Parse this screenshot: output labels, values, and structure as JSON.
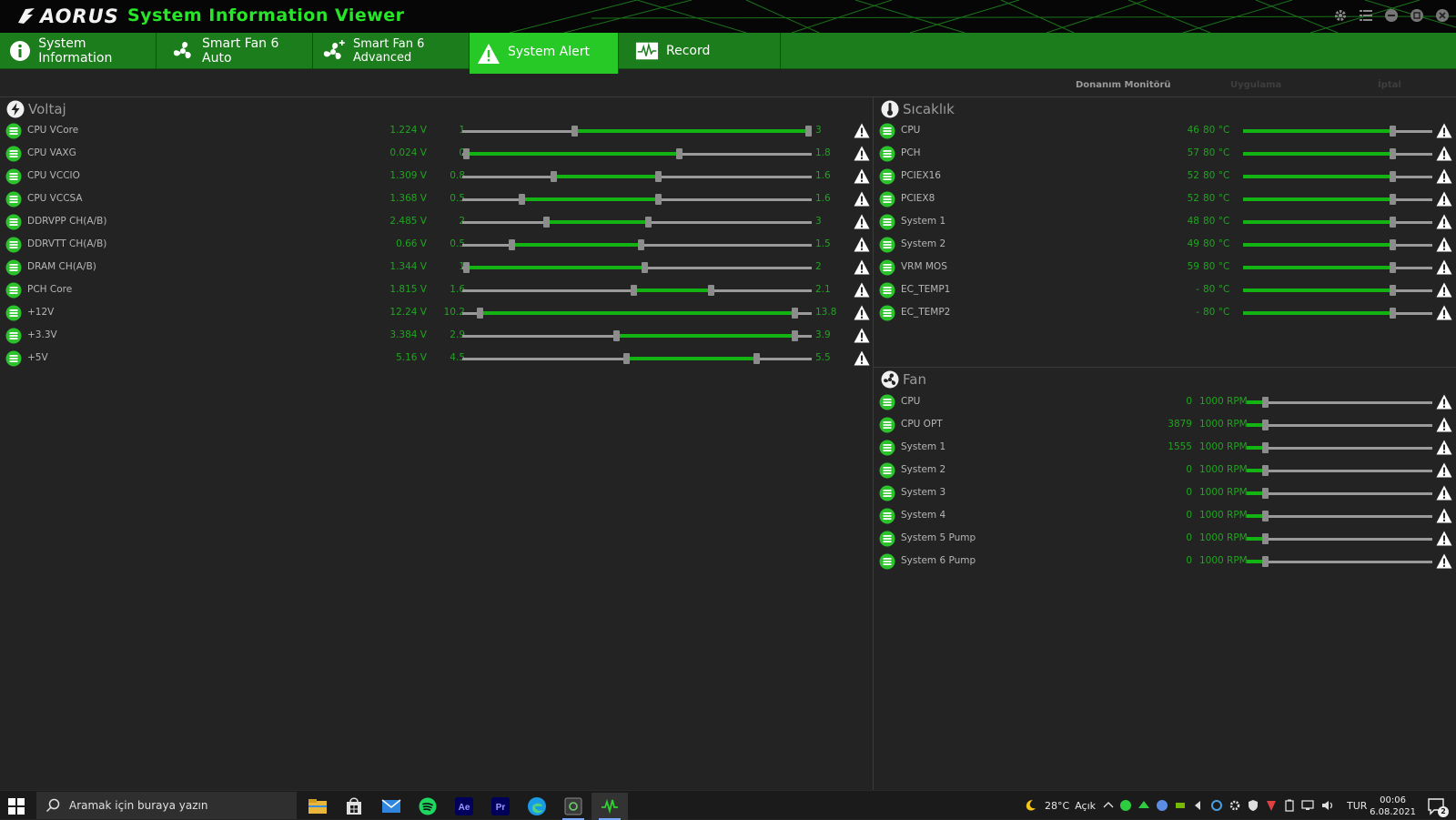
{
  "app": {
    "logo_text": "AORUS",
    "title": "System Information Viewer"
  },
  "tabs": [
    {
      "label": "System Information",
      "icon": "info-icon"
    },
    {
      "label": "Smart Fan 6 Auto",
      "icon": "fan-icon"
    },
    {
      "label": "Smart Fan 6 Advanced",
      "icon": "fan-plus-icon"
    },
    {
      "label": "System Alert",
      "icon": "warning-icon",
      "active": true
    },
    {
      "label": "Record",
      "icon": "pulse-icon"
    }
  ],
  "subheader": {
    "hardware_monitor": "Donanım Monitörü",
    "apply": "Uygulama",
    "cancel": "İptal"
  },
  "voltage": {
    "title": "Voltaj",
    "rows": [
      {
        "name": "CPU VCore",
        "value": "1.224 V",
        "min": "1",
        "max": "3",
        "low": 0.32,
        "high": 0.99
      },
      {
        "name": "CPU VAXG",
        "value": "0.024 V",
        "min": "0",
        "max": "1.8",
        "low": 0.01,
        "high": 0.62
      },
      {
        "name": "CPU VCCIO",
        "value": "1.309 V",
        "min": "0.8",
        "max": "1.6",
        "low": 0.26,
        "high": 0.56
      },
      {
        "name": "CPU VCCSA",
        "value": "1.368 V",
        "min": "0.5",
        "max": "1.6",
        "low": 0.17,
        "high": 0.56
      },
      {
        "name": "DDRVPP CH(A/B)",
        "value": "2.485 V",
        "min": "2",
        "max": "3",
        "low": 0.24,
        "high": 0.53
      },
      {
        "name": "DDRVTT CH(A/B)",
        "value": "0.66 V",
        "min": "0.5",
        "max": "1.5",
        "low": 0.14,
        "high": 0.51
      },
      {
        "name": "DRAM CH(A/B)",
        "value": "1.344 V",
        "min": "1",
        "max": "2",
        "low": 0.01,
        "high": 0.52
      },
      {
        "name": "PCH Core",
        "value": "1.815 V",
        "min": "1.6",
        "max": "2.1",
        "low": 0.49,
        "high": 0.71
      },
      {
        "name": "+12V",
        "value": "12.24 V",
        "min": "10.2",
        "max": "13.8",
        "low": 0.05,
        "high": 0.95
      },
      {
        "name": "+3.3V",
        "value": "3.384 V",
        "min": "2.9",
        "max": "3.9",
        "low": 0.44,
        "high": 0.95
      },
      {
        "name": "+5V",
        "value": "5.16 V",
        "min": "4.5",
        "max": "5.5",
        "low": 0.47,
        "high": 0.84
      }
    ]
  },
  "temperature": {
    "title": "Sıcaklık",
    "rows": [
      {
        "name": "CPU",
        "value": "46",
        "limit": "80 °C",
        "level": 0.79
      },
      {
        "name": "PCH",
        "value": "57",
        "limit": "80 °C",
        "level": 0.79
      },
      {
        "name": "PCIEX16",
        "value": "52",
        "limit": "80 °C",
        "level": 0.79
      },
      {
        "name": "PCIEX8",
        "value": "52",
        "limit": "80 °C",
        "level": 0.79
      },
      {
        "name": "System 1",
        "value": "48",
        "limit": "80 °C",
        "level": 0.79
      },
      {
        "name": "System 2",
        "value": "49",
        "limit": "80 °C",
        "level": 0.79
      },
      {
        "name": "VRM MOS",
        "value": "59",
        "limit": "80 °C",
        "level": 0.79
      },
      {
        "name": "EC_TEMP1",
        "value": "-",
        "limit": "80 °C",
        "level": 0.79
      },
      {
        "name": "EC_TEMP2",
        "value": "-",
        "limit": "80 °C",
        "level": 0.79
      }
    ]
  },
  "fan": {
    "title": "Fan",
    "rows": [
      {
        "name": "CPU",
        "value": "0",
        "limit": "1000 RPM",
        "level": 0.1
      },
      {
        "name": "CPU OPT",
        "value": "3879",
        "limit": "1000 RPM",
        "level": 0.1
      },
      {
        "name": "System 1",
        "value": "1555",
        "limit": "1000 RPM",
        "level": 0.1
      },
      {
        "name": "System 2",
        "value": "0",
        "limit": "1000 RPM",
        "level": 0.1
      },
      {
        "name": "System 3",
        "value": "0",
        "limit": "1000 RPM",
        "level": 0.1
      },
      {
        "name": "System 4",
        "value": "0",
        "limit": "1000 RPM",
        "level": 0.1
      },
      {
        "name": "System 5 Pump",
        "value": "0",
        "limit": "1000 RPM",
        "level": 0.1
      },
      {
        "name": "System 6 Pump",
        "value": "0",
        "limit": "1000 RPM",
        "level": 0.1
      }
    ]
  },
  "taskbar": {
    "search_placeholder": "Aramak için buraya yazın",
    "weather_temp": "28°C",
    "weather_text": "Açık",
    "language": "TUR",
    "time": "00:06",
    "date": "6.08.2021",
    "notification_count": "2",
    "apps": [
      {
        "icon": "file-explorer-icon"
      },
      {
        "icon": "store-icon"
      },
      {
        "icon": "mail-icon"
      },
      {
        "icon": "spotify-icon"
      },
      {
        "icon": "after-effects-icon",
        "text": "Ae"
      },
      {
        "icon": "premiere-icon",
        "text": "Pr"
      },
      {
        "icon": "edge-icon"
      },
      {
        "icon": "app-icon"
      },
      {
        "icon": "sysinfo-viewer-icon"
      }
    ]
  },
  "colors": {
    "accent": "#26c926",
    "tab_bar": "#1c7d1c",
    "value_green": "#1fa51f",
    "background": "#232323"
  }
}
